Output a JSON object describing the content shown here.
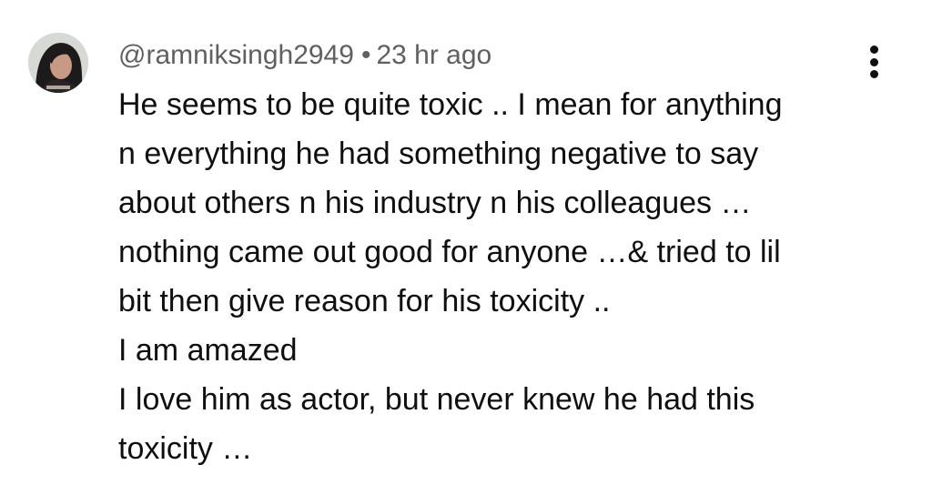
{
  "comment": {
    "author": "@ramniksingh2949",
    "separator": "•",
    "timestamp": "23 hr ago",
    "avatar_icon": "user-avatar-icon",
    "menu_icon": "more-vertical-icon",
    "text_lines": [
      "He seems to be quite toxic .. I mean for anything",
      "n everything he had something negative to say",
      "about others n his industry n his colleagues …",
      "nothing came out good for anyone …& tried to lil",
      "bit then give reason for his toxicity ..",
      "I am amazed",
      "I love him as actor, but never knew he had this",
      "toxicity …"
    ]
  },
  "colors": {
    "text_primary": "#0f0f0f",
    "text_secondary": "#606060",
    "background": "#ffffff"
  }
}
